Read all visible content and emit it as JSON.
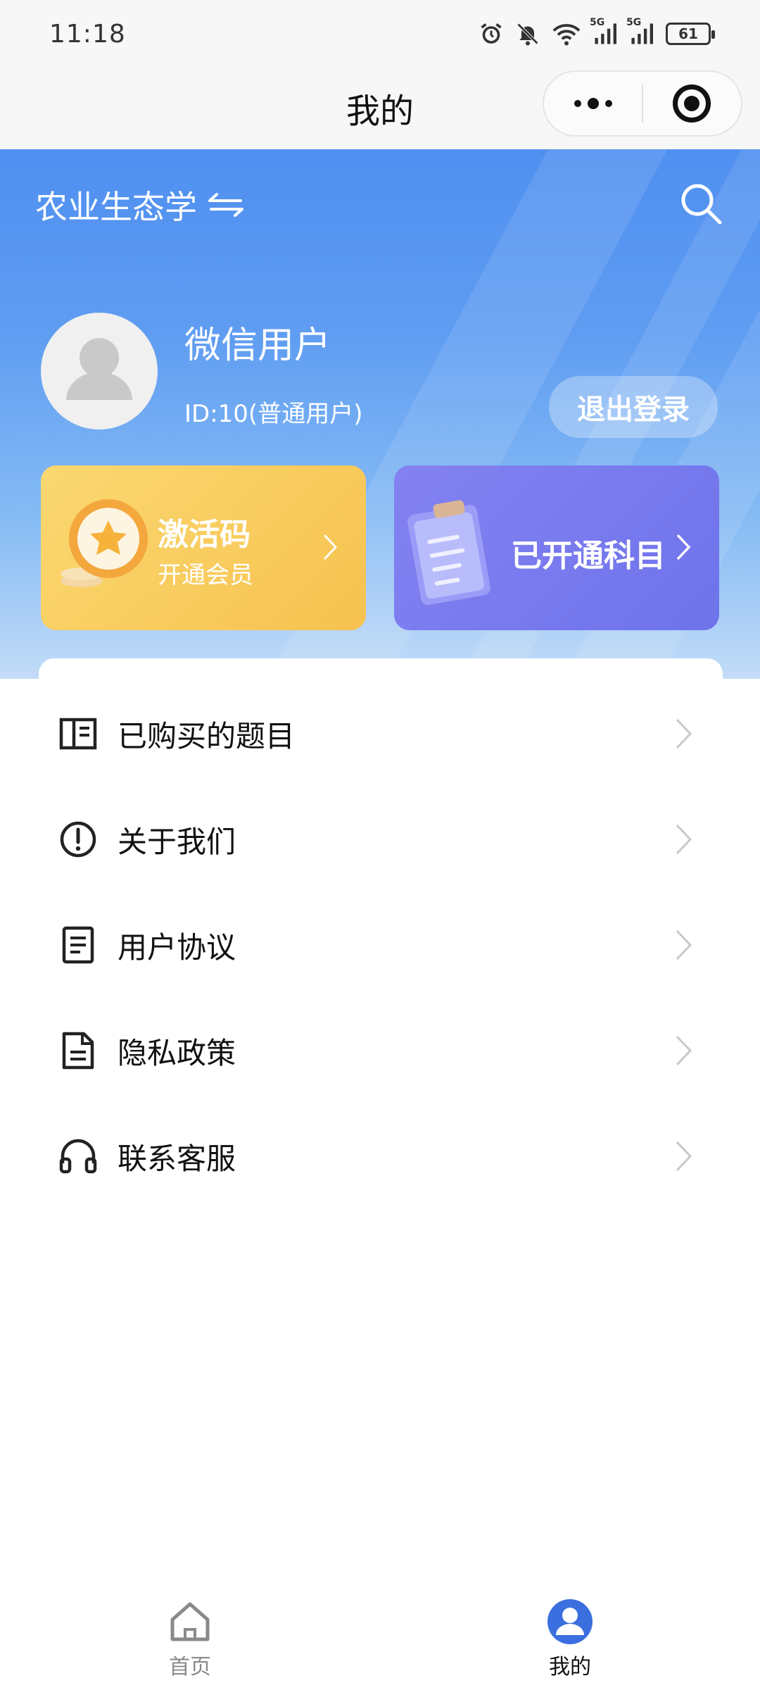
{
  "status_bar": {
    "time": "11:18",
    "network_label_1": "5G",
    "network_label_2": "5G",
    "battery": "61",
    "icons": [
      "alarm-icon",
      "mute-icon",
      "wifi-icon",
      "signal-icon",
      "signal-icon",
      "battery-icon"
    ]
  },
  "nav": {
    "title": "我的",
    "icons": [
      "more-icon",
      "close-miniprogram-icon"
    ]
  },
  "hero": {
    "subject_name": "农业生态学",
    "switch_icon": "switch-icon",
    "search_icon": "search-icon",
    "user_name": "微信用户",
    "user_id": "ID:10(普通用户)",
    "logout_label": "退出登录",
    "colors": {
      "gradient_top": "#4f8ff0",
      "gradient_bottom": "#c3dcf8"
    }
  },
  "cards": {
    "activate": {
      "title": "激活码",
      "subtitle": "开通会员",
      "icon": "coin-star-icon",
      "color": "#f8c955"
    },
    "subjects": {
      "title": "已开通科目",
      "icon": "clipboard-icon",
      "color": "#7679ee"
    }
  },
  "menu": [
    {
      "label": "已购买的题目",
      "icon": "book-icon"
    },
    {
      "label": "关于我们",
      "icon": "info-icon"
    },
    {
      "label": "用户协议",
      "icon": "document-icon"
    },
    {
      "label": "隐私政策",
      "icon": "file-icon"
    },
    {
      "label": "联系客服",
      "icon": "headset-icon"
    }
  ],
  "tabs": [
    {
      "label": "首页",
      "icon": "home-icon",
      "active": false
    },
    {
      "label": "我的",
      "icon": "user-icon",
      "active": true
    }
  ],
  "colors": {
    "accent": "#3b6fe0",
    "tab_inactive": "#8a8a8a"
  }
}
